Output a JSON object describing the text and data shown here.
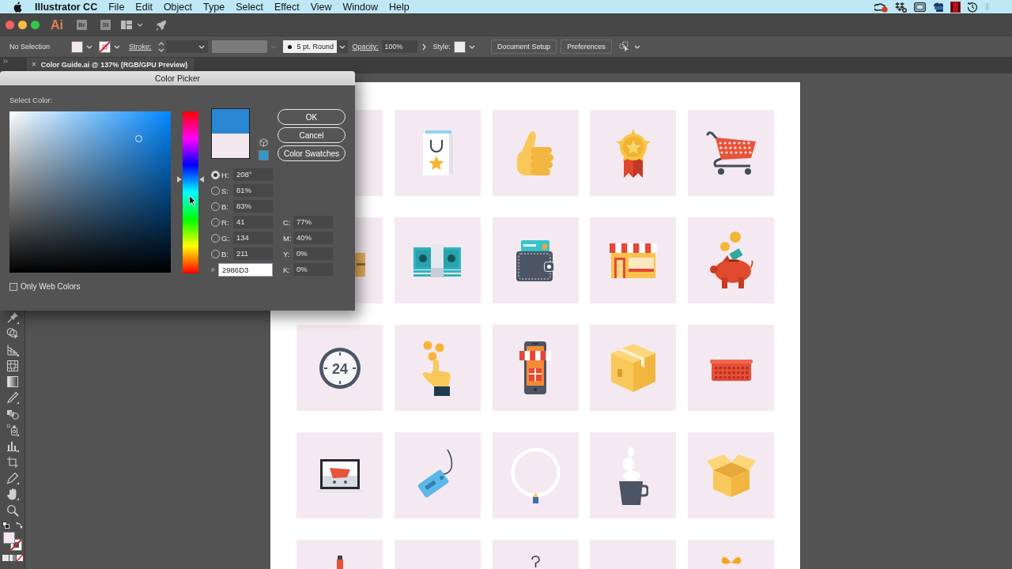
{
  "menu_bar": {
    "app_name": "Illustrator CC",
    "menus": [
      "File",
      "Edit",
      "Object",
      "Type",
      "Select",
      "Effect",
      "View",
      "Window",
      "Help"
    ]
  },
  "app_bar": {
    "logo": "Ai",
    "bridge_button": "Br",
    "stock_button": "St"
  },
  "control_bar": {
    "selection": "No Selection",
    "stroke_label": "Stroke:",
    "brush": "5 pt. Round",
    "opacity_label": "Opacity:",
    "opacity": "100%",
    "style_label": "Style:",
    "buttons": [
      "Document Setup",
      "Preferences"
    ]
  },
  "document_tab": {
    "close": "×",
    "title": "Color Guide.ai @ 137% (RGB/GPU Preview)"
  },
  "color_picker": {
    "title": "Color Picker",
    "prompt": "Select Color:",
    "hue_slider": {
      "level": 0.58
    },
    "preview": [
      {
        "color": "#2986d3"
      },
      {
        "color": "#f3e8ef"
      }
    ],
    "buttons": [
      "OK",
      "Cancel",
      "Color Swatches"
    ],
    "fields": [
      {
        "label": "H:",
        "value": "208°",
        "selected": true
      },
      {
        "label": "S:",
        "value": "81%",
        "selected": false
      },
      {
        "label": "B:",
        "value": "83%",
        "selected": false
      },
      {
        "label": "R:",
        "value": "41",
        "selected": false
      },
      {
        "label": "G:",
        "value": "134",
        "selected": false
      },
      {
        "label": "B:",
        "value": "211",
        "selected": false
      }
    ],
    "hex": {
      "label": "#",
      "value": "2986D3"
    },
    "cmyk": [
      {
        "label": "C:",
        "value": "77%"
      },
      {
        "label": "M:",
        "value": "40%"
      },
      {
        "label": "Y:",
        "value": "0%"
      },
      {
        "label": "K:",
        "value": "0%"
      }
    ],
    "web_colors": {
      "label": "Only Web Colors",
      "checked": false
    }
  },
  "artboard": {
    "clock_text": "24"
  }
}
